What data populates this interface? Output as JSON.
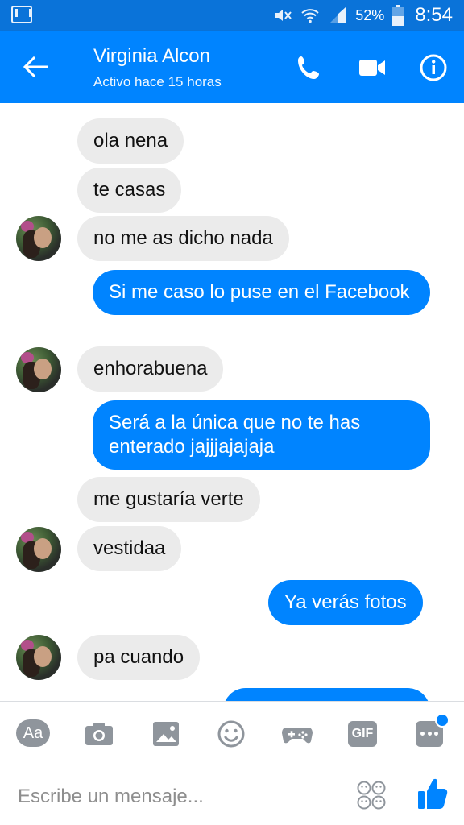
{
  "status_bar": {
    "battery": "52%",
    "time": "8:54",
    "icons": [
      "mail-icon",
      "mute-icon",
      "wifi-icon",
      "signal-icon",
      "battery-icon"
    ]
  },
  "header": {
    "contact_name": "Virginia Alcon",
    "status": "Activo hace 15 horas",
    "icons": [
      "back-arrow-icon",
      "phone-icon",
      "video-icon",
      "info-icon"
    ],
    "color": "#0084ff"
  },
  "messages": [
    {
      "side": "in",
      "text": "ola nena"
    },
    {
      "side": "in",
      "text": "te casas"
    },
    {
      "side": "in",
      "text": "no me as dicho nada"
    },
    {
      "side": "out",
      "text": "Si me caso lo puse en el Facebook"
    },
    {
      "side": "in",
      "text": "enhorabuena"
    },
    {
      "side": "out",
      "text": "Será a la única que no te has enterado jajjjajajaja"
    },
    {
      "side": "in",
      "text": "me gustaría verte"
    },
    {
      "side": "in",
      "text": "vestidaa"
    },
    {
      "side": "out",
      "text": "Ya verás fotos"
    },
    {
      "side": "in",
      "text": "pa cuando"
    },
    {
      "side": "out",
      "text": ""
    }
  ],
  "composer": {
    "aa_label": "Aa",
    "gif_label": "GIF",
    "placeholder": "Escribe un mensaje...",
    "tools": [
      "text-format-icon",
      "camera-icon",
      "gallery-icon",
      "emoji-icon",
      "game-icon",
      "gif-icon",
      "more-icon"
    ]
  },
  "colors": {
    "outgoing_bubble": "#0084ff",
    "incoming_bubble": "#ebebeb",
    "status_bar": "#0a73d9"
  }
}
